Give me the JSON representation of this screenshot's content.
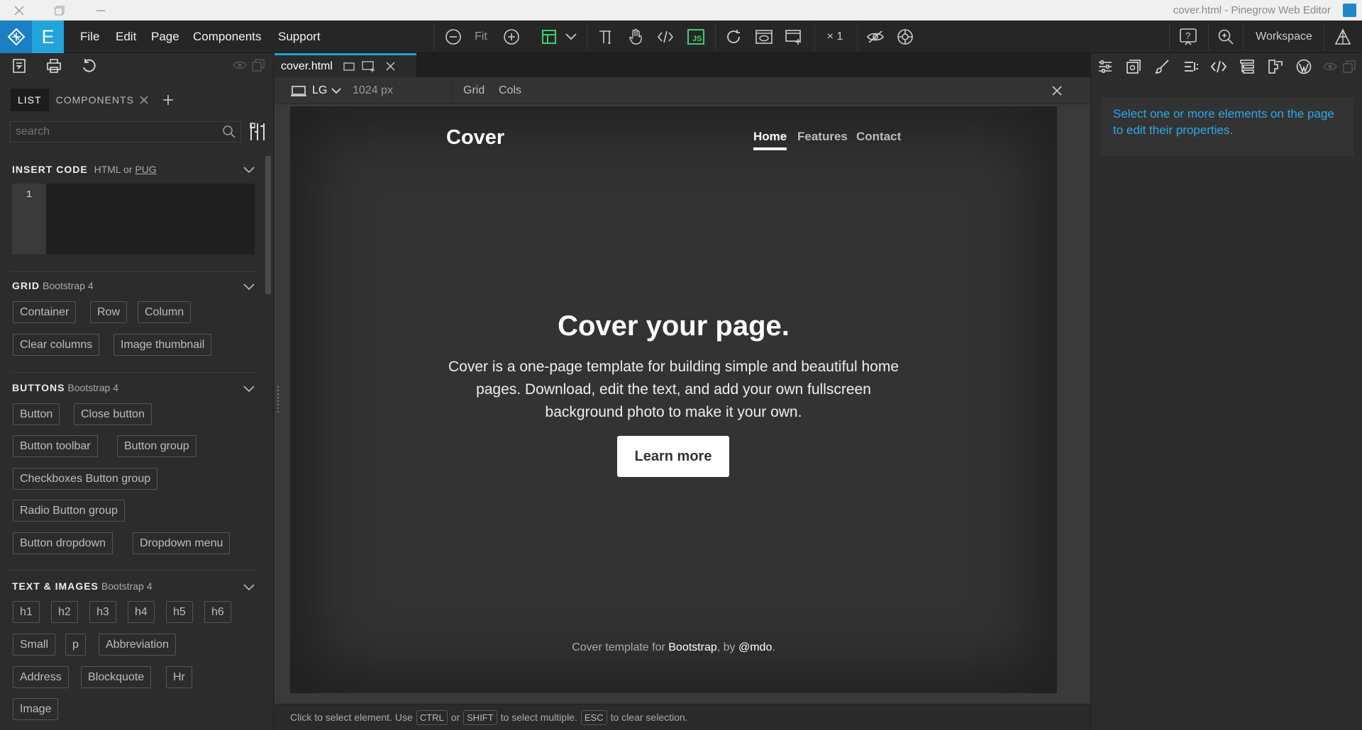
{
  "window": {
    "title": "cover.html - Pinegrow Web Editor"
  },
  "menubar": {
    "logo_letter": "E",
    "menu": [
      "File",
      "Edit",
      "Page",
      "Components",
      "Support"
    ],
    "zoom_fit": "Fit",
    "multiplier": "× 1",
    "workspace": "Workspace"
  },
  "left": {
    "tabs": {
      "list": "LIST",
      "components": "COMPONENTS"
    },
    "search_placeholder": "search",
    "insert_code": {
      "title": "INSERT CODE",
      "sub_a": "HTML or",
      "sub_b": "PUG",
      "line_number": "1"
    },
    "grid": {
      "title": "GRID",
      "sub": "Bootstrap 4",
      "items": [
        "Container",
        "Row",
        "Column",
        "Clear columns",
        "Image thumbnail"
      ]
    },
    "buttons": {
      "title": "BUTTONS",
      "sub": "Bootstrap 4",
      "items": [
        "Button",
        "Close button",
        "Button toolbar",
        "Button group",
        "Checkboxes Button group",
        "Radio Button group",
        "Button dropdown",
        "Dropdown menu"
      ]
    },
    "text_images": {
      "title": "TEXT & IMAGES",
      "sub": "Bootstrap 4",
      "items": [
        "h1",
        "h2",
        "h3",
        "h4",
        "h5",
        "h6",
        "Small",
        "p",
        "Abbreviation",
        "Address",
        "Blockquote",
        "Hr",
        "Image"
      ]
    }
  },
  "center": {
    "tab_name": "cover.html",
    "breakpoint": "LG",
    "width_label": "1024 px",
    "grid": "Grid",
    "cols": "Cols",
    "page": {
      "brand": "Cover",
      "nav": [
        "Home",
        "Features",
        "Contact"
      ],
      "heading": "Cover your page.",
      "lead": "Cover is a one-page template for building simple and beautiful home pages. Download, edit the text, and add your own fullscreen background photo to make it your own.",
      "button": "Learn more",
      "footer_a": "Cover template for",
      "footer_b": "Bootstrap",
      "footer_c": ", by",
      "footer_d": "@mdo",
      "footer_e": "."
    },
    "status": {
      "a": "Click to select element. Use",
      "k1": "CTRL",
      "b": "or",
      "k2": "SHIFT",
      "c": "to select multiple.",
      "k3": "ESC",
      "d": "to clear selection."
    }
  },
  "right": {
    "hint": "Select one or more elements on the page to edit their properties."
  },
  "colors": {
    "accent": "#22a3dc",
    "hint_text": "#2ea8e6",
    "logo_dark": "#1b7fc4"
  }
}
